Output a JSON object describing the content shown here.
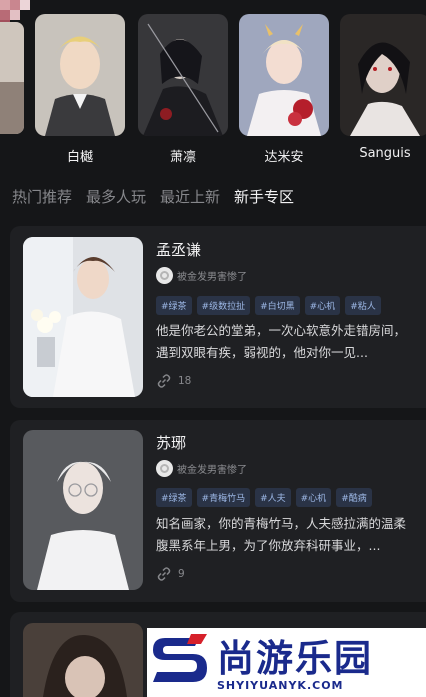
{
  "characters": [
    {
      "name": "白樾"
    },
    {
      "name": "萧凛"
    },
    {
      "name": "达米安"
    },
    {
      "name": "Sanguis"
    }
  ],
  "tabs": [
    {
      "label": "热门推荐",
      "active": false
    },
    {
      "label": "最多人玩",
      "active": false
    },
    {
      "label": "最近上新",
      "active": false
    },
    {
      "label": "新手专区",
      "active": true
    }
  ],
  "cards": [
    {
      "title": "孟丞谦",
      "author": "被金发男害惨了",
      "tags": [
        "#绿茶",
        "#级数拉扯",
        "#白切黑",
        "#心机",
        "#粘人"
      ],
      "description": "他是你老公的堂弟，一次心软意外走错房间，遇到双眼有疾，弱视的，他对你一见...",
      "count": "18"
    },
    {
      "title": "苏琊",
      "author": "被金发男害惨了",
      "tags": [
        "#绿茶",
        "#青梅竹马",
        "#人夫",
        "#心机",
        "#酷病"
      ],
      "description": "知名画家，你的青梅竹马，人夫感拉满的温柔腹黑系年上男，为了你放弃科研事业，...",
      "count": "9"
    }
  ],
  "watermark": {
    "brand": "尚游乐园",
    "url": "SHYIYUANYK.COM"
  },
  "colors": {
    "background": "#151618",
    "card": "#1f2023",
    "tag_text": "#9db8e6",
    "tag_bg": "#2a3346",
    "watermark_blue": "#1a2a8c"
  }
}
